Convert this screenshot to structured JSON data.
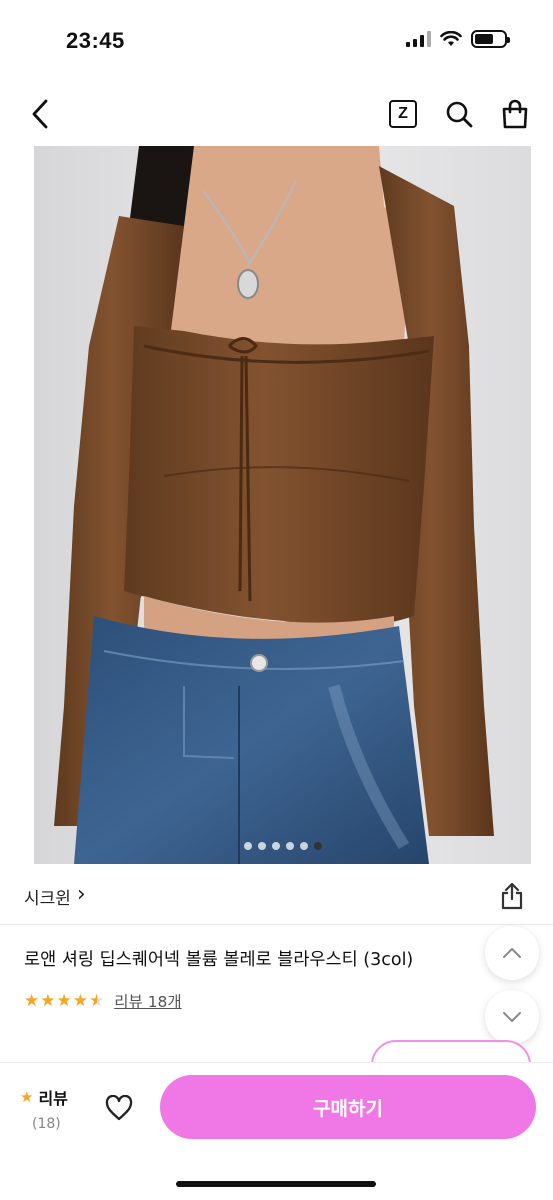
{
  "status_bar": {
    "time": "23:45"
  },
  "nav": {
    "brand_badge": "Z"
  },
  "carousel": {
    "dot_count": 6,
    "active_index": 5
  },
  "store": {
    "name": "시크윈",
    "chevron": "›"
  },
  "product": {
    "title": "로앤 셔링 딥스퀘어넥 볼륨 볼레로 블라우스티 (3col)"
  },
  "rating": {
    "stars": "★★★★★",
    "value": 4.5,
    "review_link": "리뷰 18개"
  },
  "price_peek": "",
  "bottom_bar": {
    "review_label": "리뷰",
    "review_count": "(18)",
    "buy_label": "구매하기"
  },
  "colors": {
    "accent": "#f078e6",
    "star": "#f5a623",
    "top_brown": "#7a4a28"
  }
}
